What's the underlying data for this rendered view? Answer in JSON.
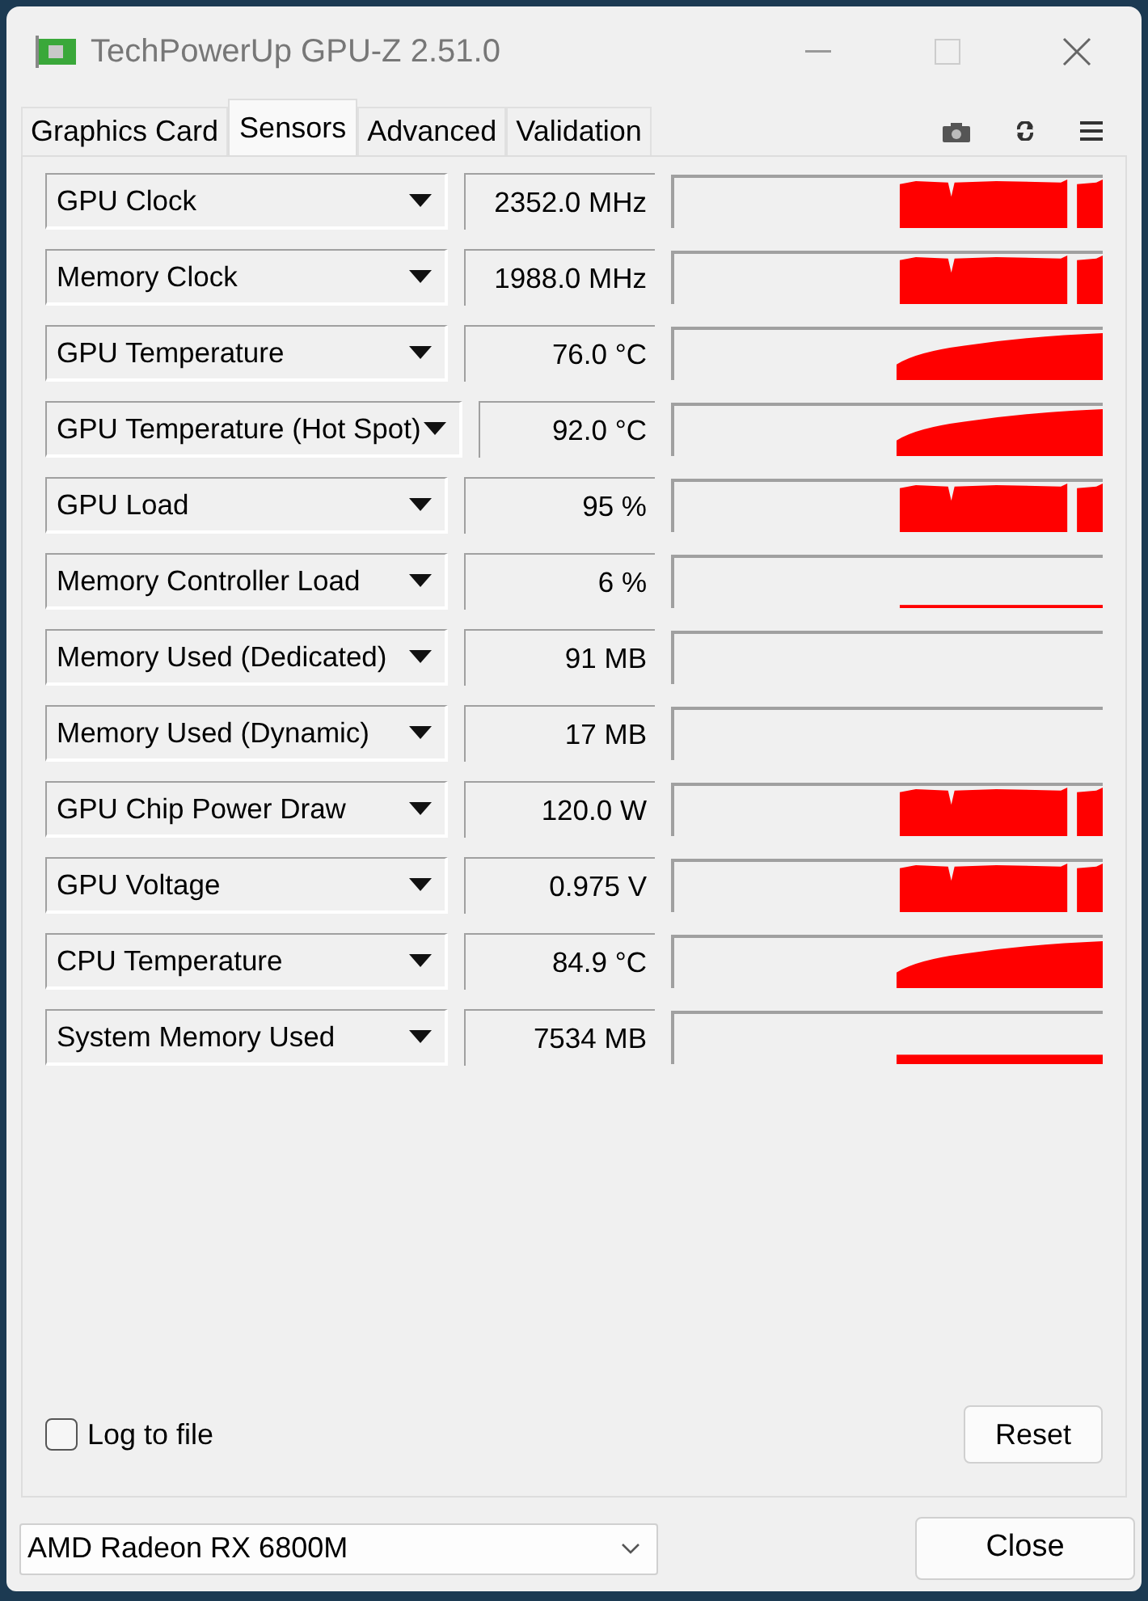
{
  "window": {
    "title": "TechPowerUp GPU-Z 2.51.0"
  },
  "tabs": [
    {
      "label": "Graphics Card",
      "selected": false
    },
    {
      "label": "Sensors",
      "selected": true
    },
    {
      "label": "Advanced",
      "selected": false
    },
    {
      "label": "Validation",
      "selected": false
    }
  ],
  "sensors": [
    {
      "name": "GPU Clock",
      "reading": "2352.0 MHz",
      "kind": "block"
    },
    {
      "name": "Memory Clock",
      "reading": "1988.0 MHz",
      "kind": "block"
    },
    {
      "name": "GPU Temperature",
      "reading": "76.0 °C",
      "kind": "ramp"
    },
    {
      "name": "GPU Temperature (Hot Spot)",
      "reading": "92.0 °C",
      "kind": "ramp"
    },
    {
      "name": "GPU Load",
      "reading": "95 %",
      "kind": "block"
    },
    {
      "name": "Memory Controller Load",
      "reading": "6 %",
      "kind": "baseline"
    },
    {
      "name": "Memory Used (Dedicated)",
      "reading": "91 MB",
      "kind": "empty"
    },
    {
      "name": "Memory Used (Dynamic)",
      "reading": "17 MB",
      "kind": "empty"
    },
    {
      "name": "GPU Chip Power Draw",
      "reading": "120.0 W",
      "kind": "block"
    },
    {
      "name": "GPU Voltage",
      "reading": "0.975 V",
      "kind": "block"
    },
    {
      "name": "CPU Temperature",
      "reading": "84.9 °C",
      "kind": "ramp"
    },
    {
      "name": "System Memory Used",
      "reading": "7534 MB",
      "kind": "bar"
    }
  ],
  "log_to_file": {
    "label": "Log to file",
    "checked": false
  },
  "reset_button": "Reset",
  "gpu_select": {
    "value": "AMD Radeon RX 6800M"
  },
  "close_button": "Close"
}
